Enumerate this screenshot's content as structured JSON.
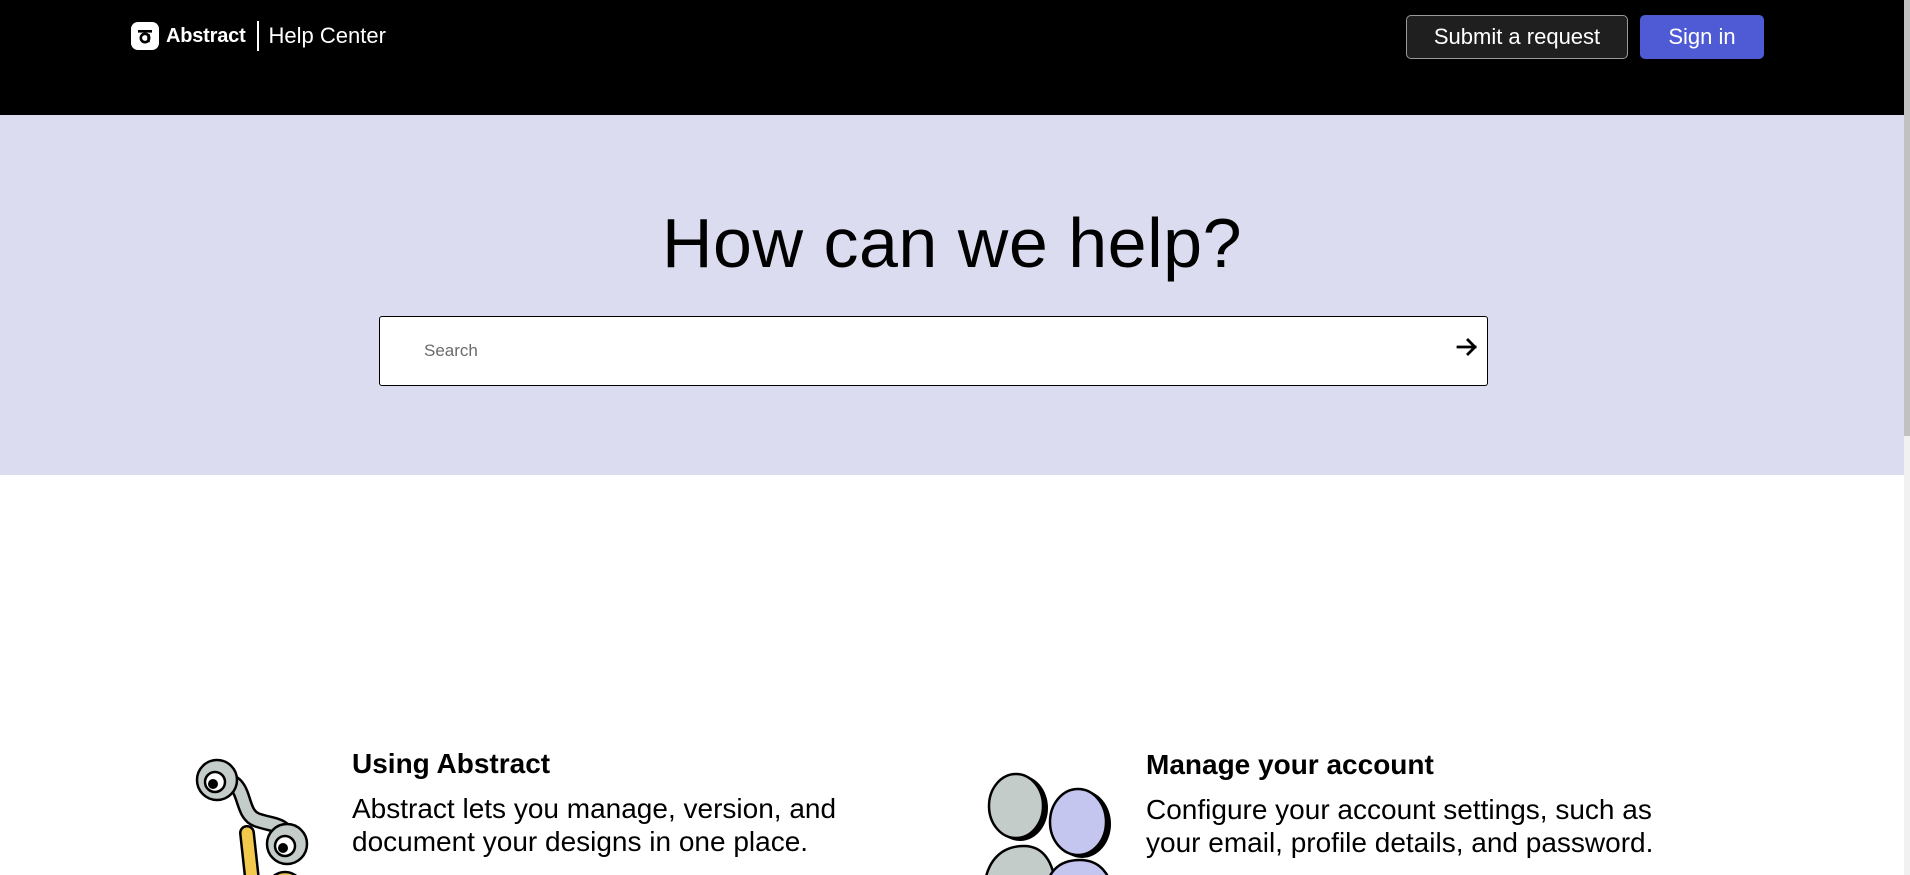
{
  "header": {
    "brand": "Abstract",
    "section": "Help Center",
    "submit_label": "Submit a request",
    "signin_label": "Sign in"
  },
  "hero": {
    "title": "How can we help?",
    "search_placeholder": "Search"
  },
  "categories": [
    {
      "title": "Using Abstract",
      "description": "Abstract lets you manage, version, and document your designs in one place.",
      "icon": "branching-nodes-icon"
    },
    {
      "title": "Manage your account",
      "description": "Configure your account settings, such as your email, profile details, and password.",
      "icon": "people-icon"
    }
  ],
  "colors": {
    "header_bg": "#000000",
    "hero_bg": "#dcdcf0",
    "signin_bg": "#4f5bd5",
    "accent_yellow": "#f2c94c",
    "accent_gray": "#c3ccc8",
    "accent_lavender": "#c5c6f0"
  }
}
